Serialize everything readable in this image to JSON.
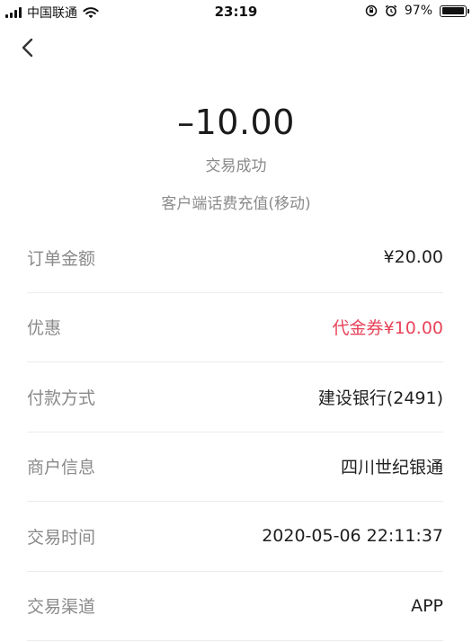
{
  "status_bar": {
    "carrier": "中国联通",
    "time": "23:19",
    "battery_percent": "97%",
    "battery_level": 0.97,
    "icons": [
      "signal-icon",
      "wifi-icon",
      "rotation-lock-icon",
      "alarm-icon",
      "battery-icon"
    ]
  },
  "nav": {
    "back_icon": "chevron-left-icon"
  },
  "transaction": {
    "amount": "–10.00",
    "status": "交易成功",
    "description": "客户端话费充值(移动)"
  },
  "details": [
    {
      "label": "订单金额",
      "value": "¥20.00"
    },
    {
      "label": "优惠",
      "value": "代金券¥10.00"
    },
    {
      "label": "付款方式",
      "value": "建设银行(2491)"
    },
    {
      "label": "商户信息",
      "value": "四川世纪银通"
    },
    {
      "label": "交易时间",
      "value": "2020-05-06 22:11:37"
    },
    {
      "label": "交易渠道",
      "value": "APP"
    }
  ],
  "colors": {
    "discount": "#e8445a",
    "label": "#8a8a8a",
    "value": "#1f1f1f"
  }
}
